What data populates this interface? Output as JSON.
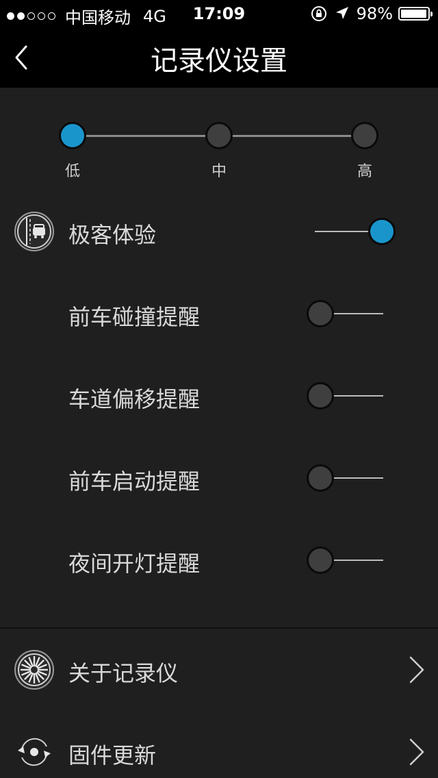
{
  "status_bar": {
    "signal_filled": 2,
    "signal_total": 5,
    "carrier": "中国移动",
    "network": "4G",
    "time": "17:09",
    "battery_text": "98%",
    "battery_level": 0.98
  },
  "nav": {
    "title": "记录仪设置",
    "back_icon": "chevron-left-icon"
  },
  "sensitivity": {
    "levels": [
      "低",
      "中",
      "高"
    ],
    "selected_index": 0
  },
  "settings": [
    {
      "label": "极客体验",
      "on": true,
      "icon": "car-lane-icon"
    },
    {
      "label": "前车碰撞提醒",
      "on": false
    },
    {
      "label": "车道偏移提醒",
      "on": false
    },
    {
      "label": "前车启动提醒",
      "on": false
    },
    {
      "label": "夜间开灯提醒",
      "on": false
    }
  ],
  "menu": [
    {
      "label": "关于记录仪",
      "icon": "wheel-icon"
    },
    {
      "label": "固件更新",
      "icon": "refresh-icon"
    }
  ],
  "colors": {
    "accent": "#1a95cc",
    "knob_off": "#3f3f3f",
    "background": "#1f1f1f",
    "bar": "#000000"
  }
}
